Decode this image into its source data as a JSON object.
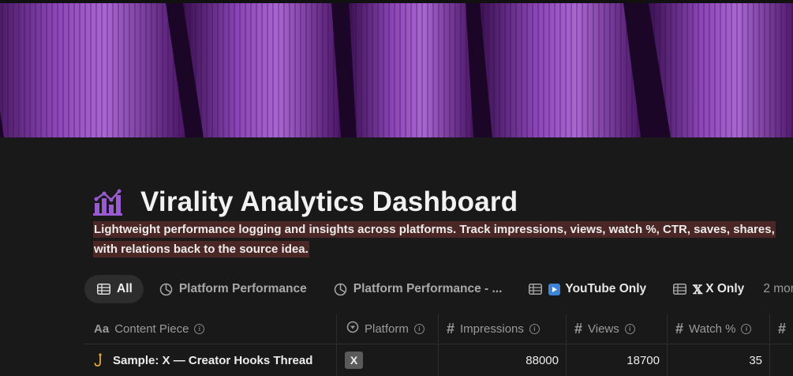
{
  "page": {
    "title": "Virality Analytics Dashboard",
    "title_icon": "bar-chart-icon",
    "description": "Lightweight performance logging and insights across platforms. Track impressions, views, watch %, CTR, saves, shares, with relations back to the source idea."
  },
  "views": {
    "tabs": [
      {
        "label": "All",
        "icon": "table-icon",
        "active": true
      },
      {
        "label": "Platform Performance",
        "icon": "pie-chart-icon"
      },
      {
        "label": "Platform Performance - ...",
        "icon": "pie-chart-icon"
      },
      {
        "label": "YouTube Only",
        "icon": "table-icon",
        "badge": "youtube-play-icon"
      },
      {
        "label": "X Only",
        "icon": "table-icon",
        "prefix": "𝕏"
      }
    ],
    "more_label": "2 mor"
  },
  "table": {
    "columns": [
      {
        "label": "Content Piece",
        "type_icon": "Aa"
      },
      {
        "label": "Platform",
        "type_icon": "select-icon"
      },
      {
        "label": "Impressions",
        "type_icon": "#"
      },
      {
        "label": "Views",
        "type_icon": "#"
      },
      {
        "label": "Watch %",
        "type_icon": "#"
      },
      {
        "label": "",
        "type_icon": "#"
      }
    ],
    "rows": [
      {
        "content_piece": "Sample: X — Creator Hooks Thread",
        "row_icon": "hook-icon",
        "platform": "X",
        "impressions": "88000",
        "views": "18700",
        "watch_pct": "35"
      }
    ]
  },
  "colors": {
    "background": "#191919",
    "description_highlight": "#4a2724",
    "cover_purple": "#7b3ba3",
    "title_icon": "#9a5bd1",
    "youtube_badge": "#3b84d8"
  }
}
